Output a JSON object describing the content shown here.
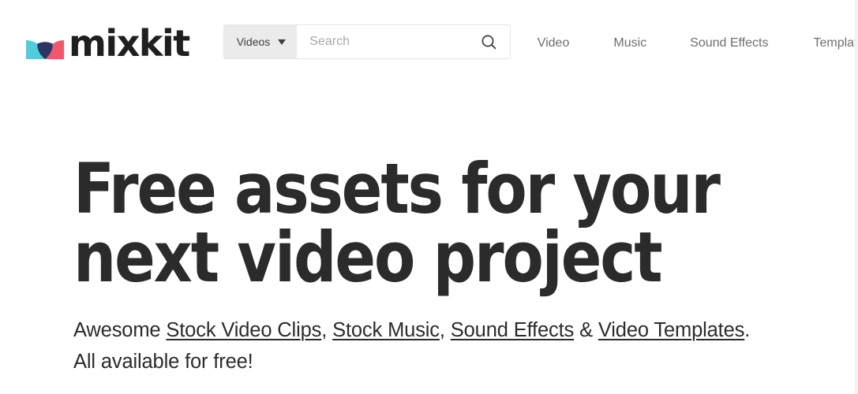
{
  "site": {
    "brand_name": "mixkit",
    "logo_colors": {
      "teal": "#50cdda",
      "pink": "#f4566b",
      "navy": "#2e3364",
      "wordmark": "#1f1f1f"
    }
  },
  "header": {
    "search": {
      "category_label": "Videos",
      "category_icon": "chevron-down-icon",
      "placeholder": "Search",
      "value": "",
      "submit_icon": "search-icon"
    },
    "nav_items": [
      {
        "label": "Video",
        "has_dropdown": false
      },
      {
        "label": "Music",
        "has_dropdown": false
      },
      {
        "label": "Sound Effects",
        "has_dropdown": false
      },
      {
        "label": "Templates",
        "has_dropdown": true,
        "dropdown_icon": "chevron-down-icon"
      }
    ]
  },
  "hero": {
    "title": "Free assets for your\nnext video project",
    "subtitle": {
      "lead": "Awesome ",
      "links": [
        {
          "label": "Stock Video Clips"
        },
        {
          "label": "Stock Music"
        },
        {
          "label": "Sound Effects"
        },
        {
          "label": "Video Templates"
        }
      ],
      "sep_comma": ", ",
      "sep_amp": " & ",
      "period": ".",
      "line2": "All available for free!"
    }
  },
  "theme": {
    "background": "#ffffff",
    "text_dark": "#2b2b2b",
    "text_muted": "#6f6f6f",
    "placeholder": "#a8a8a8",
    "select_bg": "#ebebeb",
    "border": "#e6e6e6"
  }
}
